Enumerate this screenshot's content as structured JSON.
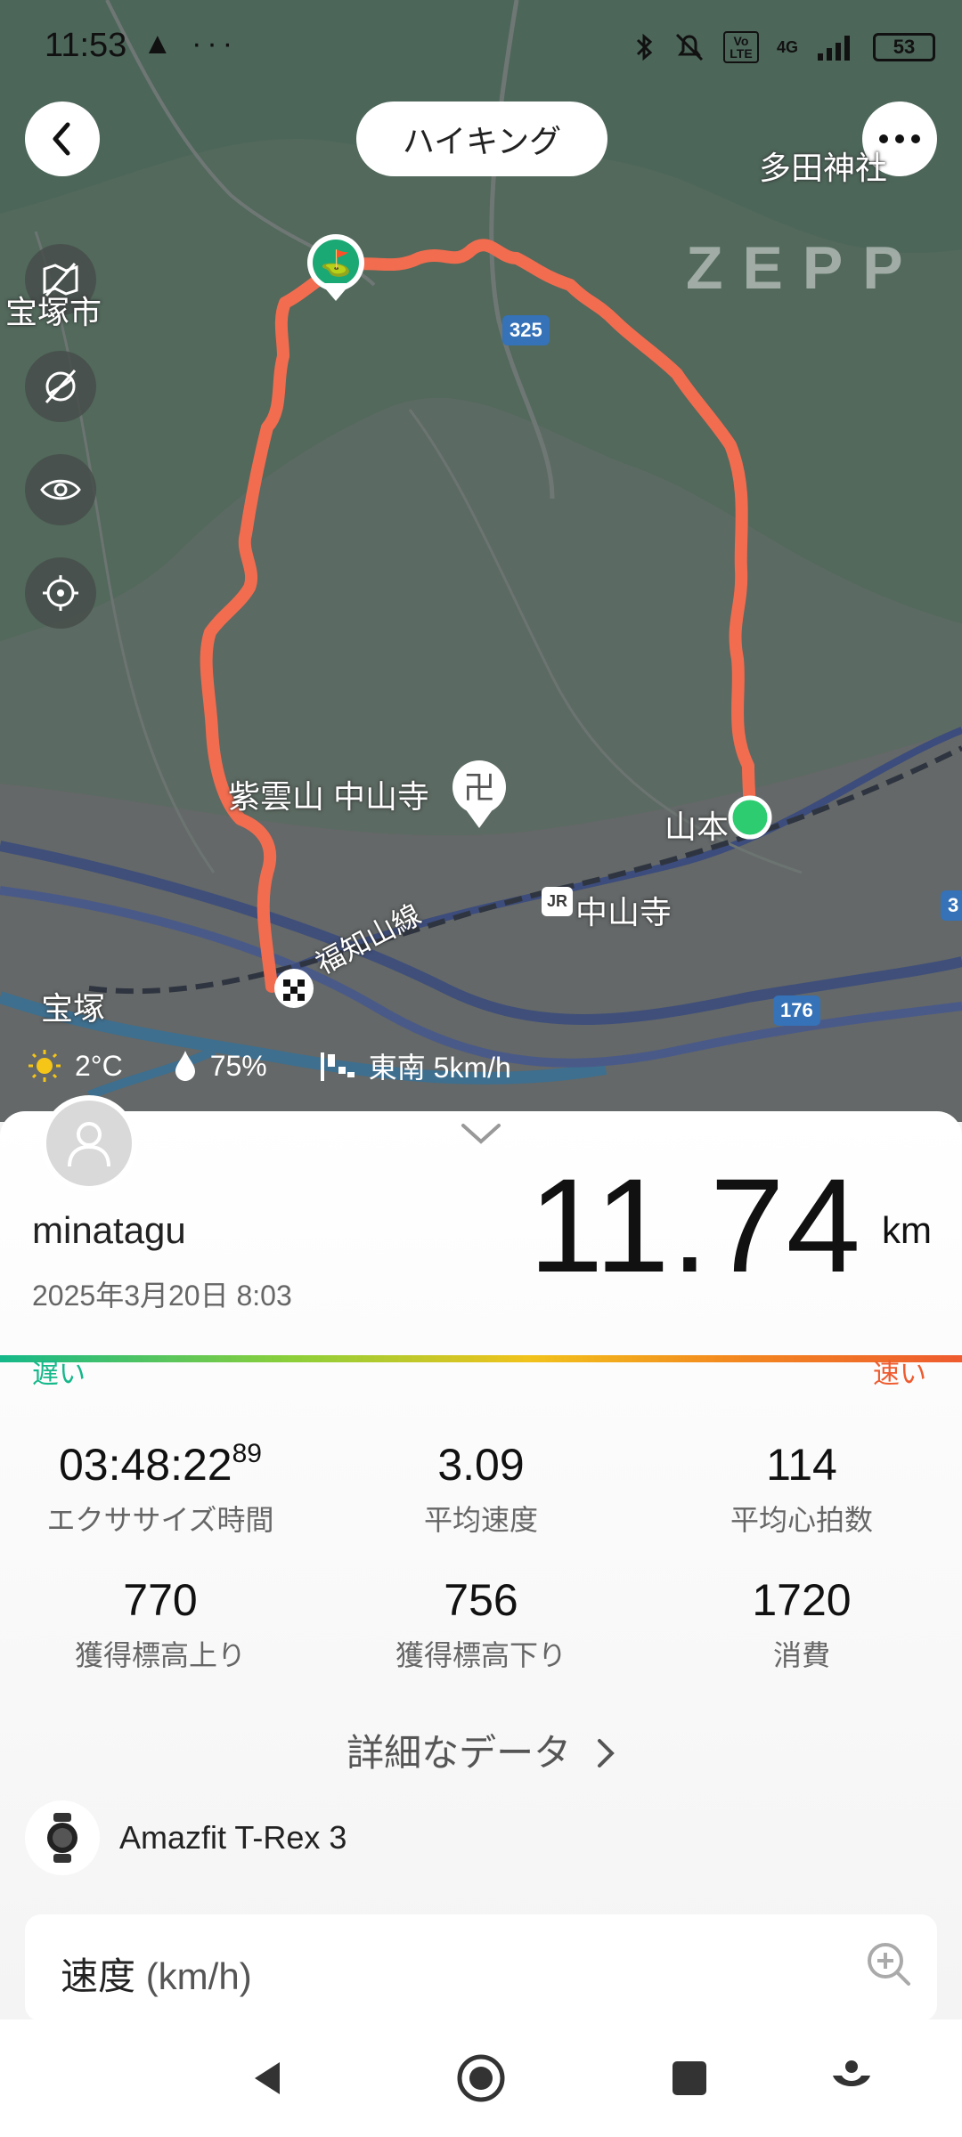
{
  "status": {
    "time": "11:53",
    "extra_icons": "▲ ···",
    "network": "4G",
    "volte": "Vo LTE",
    "battery": "53"
  },
  "header": {
    "title": "ハイキング"
  },
  "map": {
    "watermark": "ZEPP",
    "labels": {
      "tada_shrine": "多田神社",
      "takarazuka_city": "宝塚市",
      "temple": "紫雲山 中山寺",
      "yamamoto": "山本",
      "nakayamadera_station": "中山寺",
      "line": "福知山線",
      "takarazuka": "宝塚",
      "jr": "JR"
    },
    "road_badges": [
      "325",
      "176",
      "3"
    ]
  },
  "weather": {
    "temperature": "2°C",
    "humidity": "75%",
    "wind": "東南 5km/h"
  },
  "summary": {
    "user_name": "minatagu",
    "date": "2025年3月20日 8:03",
    "distance": "11.74",
    "distance_unit": "km",
    "slow_label": "遅い",
    "fast_label": "速い"
  },
  "stats": [
    {
      "value": "03:48:22",
      "sup": "89",
      "label": "エクササイズ時間"
    },
    {
      "value": "3.09",
      "label": "平均速度"
    },
    {
      "value": "114",
      "label": "平均心拍数"
    },
    {
      "value": "770",
      "label": "獲得標高上り"
    },
    {
      "value": "756",
      "label": "獲得標高下り"
    },
    {
      "value": "1720",
      "label": "消費"
    }
  ],
  "details_link": "詳細なデータ",
  "device": {
    "name": "Amazfit T-Rex 3"
  },
  "speed_card": {
    "title": "速度",
    "unit": "(km/h)"
  },
  "colors": {
    "route": "#f26c4f",
    "start_point": "#2ecc71",
    "slow": "#15b88a",
    "fast": "#ee5b2f"
  }
}
